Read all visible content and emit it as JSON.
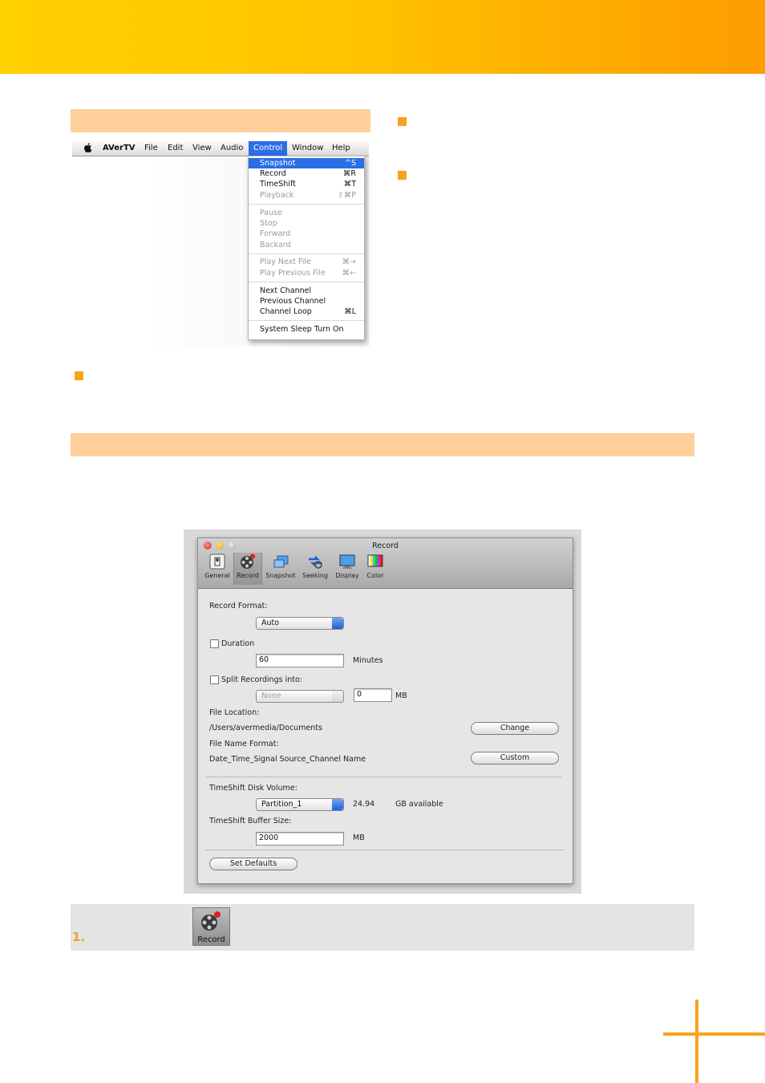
{
  "menubar": {
    "items": [
      "AVerTV",
      "File",
      "Edit",
      "View",
      "Audio",
      "Control",
      "Window",
      "Help"
    ],
    "active": "Control"
  },
  "control_menu": {
    "items": [
      {
        "label": "Snapshot",
        "shortcut": "^S",
        "state": "highlighted"
      },
      {
        "label": "Record",
        "shortcut": "⌘R",
        "state": "enabled"
      },
      {
        "label": "TimeShift",
        "shortcut": "⌘T",
        "state": "enabled"
      },
      {
        "label": "Playback",
        "shortcut": "⇧⌘P",
        "state": "disabled"
      },
      {
        "label": "Pause",
        "shortcut": "",
        "state": "disabled"
      },
      {
        "label": "Stop",
        "shortcut": "",
        "state": "disabled"
      },
      {
        "label": "Forward",
        "shortcut": "",
        "state": "disabled"
      },
      {
        "label": "Backard",
        "shortcut": "",
        "state": "disabled"
      },
      {
        "label": "Play Next File",
        "shortcut": "⌘→",
        "state": "disabled"
      },
      {
        "label": "Play Previous File",
        "shortcut": "⌘←",
        "state": "disabled"
      },
      {
        "label": "Next Channel",
        "shortcut": "",
        "state": "enabled"
      },
      {
        "label": "Previous Channel",
        "shortcut": "",
        "state": "enabled"
      },
      {
        "label": "Channel Loop",
        "shortcut": "⌘L",
        "state": "enabled"
      },
      {
        "label": "System Sleep Turn On",
        "shortcut": "",
        "state": "enabled"
      }
    ]
  },
  "dialog": {
    "title": "Record",
    "toolbar": [
      "General",
      "Record",
      "Snapshot",
      "Seeking",
      "Display",
      "Color"
    ],
    "selected_tab": "Record",
    "record_format_label": "Record Format:",
    "record_format_value": "Auto",
    "duration_label": "Duration",
    "duration_value": "60",
    "duration_unit": "Minutes",
    "split_label": "Split Recordings into:",
    "split_select_value": "None",
    "split_size_value": "0",
    "split_unit": "MB",
    "file_location_label": "File Location:",
    "file_location_value": "/Users/avermedia/Documents",
    "change_button": "Change",
    "file_name_format_label": "File Name Format:",
    "file_name_format_value": "Date_Time_Signal Source_Channel Name",
    "custom_button": "Custom",
    "timeshift_volume_label": "TimeShift Disk Volume:",
    "timeshift_volume_value": "Partition_1",
    "available_value": "24.94",
    "available_unit": "GB available",
    "buffer_label": "TimeShift Buffer Size:",
    "buffer_value": "2000",
    "buffer_unit": "MB",
    "set_defaults_button": "Set Defaults"
  },
  "note": {
    "step_number": "1.",
    "icon_label": "Record"
  },
  "colors": {
    "header_start": "#ffd000",
    "header_end": "#ff9b00",
    "band": "#ffd09a",
    "accent": "#f7a21b",
    "menu_highlight": "#2a6ee8"
  }
}
